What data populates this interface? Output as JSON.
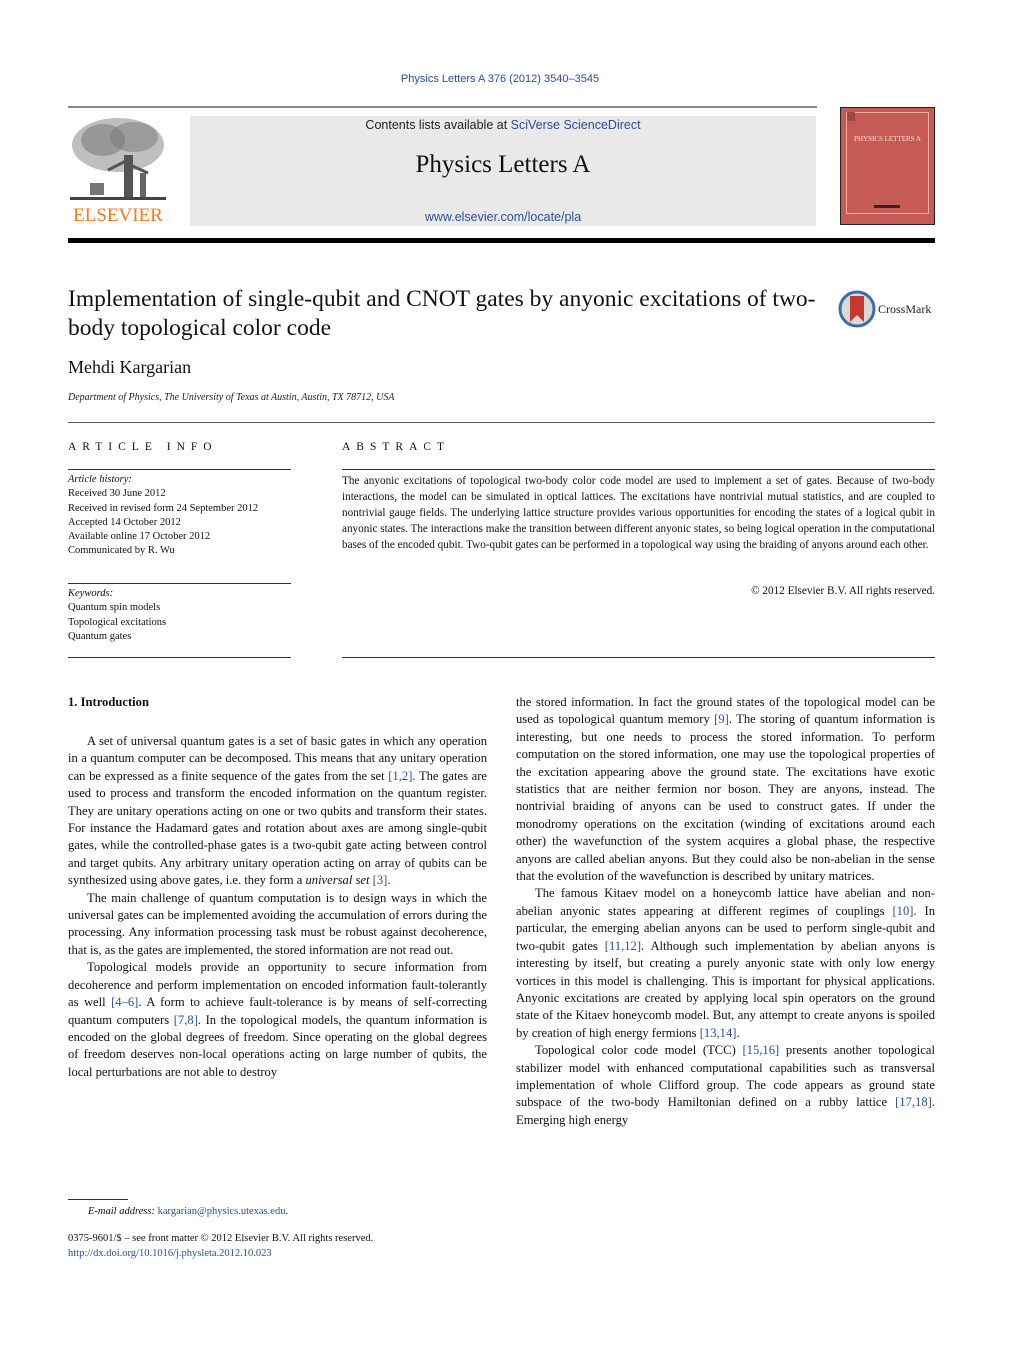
{
  "header": {
    "journal_ref": "Physics Letters A 376 (2012) 3540–3545",
    "contents_prefix": "Contents lists available at ",
    "contents_link": "SciVerse ScienceDirect",
    "journal_title": "Physics Letters A",
    "journal_url": "www.elsevier.com/locate/pla",
    "publisher_logo_text": "ELSEVIER",
    "cover_title": "PHYSICS LETTERS A",
    "colors": {
      "elsevier_orange": "#f07a20",
      "cover_red": "#c65a54",
      "link_blue": "#2a4f9a"
    }
  },
  "article": {
    "title": "Implementation of single-qubit and CNOT gates by anyonic excitations of two-body topological color code",
    "crossmark_label": "CrossMark",
    "author": "Mehdi Kargarian",
    "affiliation": "Department of Physics, The University of Texas at Austin, Austin, TX 78712, USA"
  },
  "article_info": {
    "heading": "ARTICLE INFO",
    "history_label": "Article history:",
    "history": [
      "Received 30 June 2012",
      "Received in revised form 24 September 2012",
      "Accepted 14 October 2012",
      "Available online 17 October 2012",
      "Communicated by R. Wu"
    ],
    "keywords_label": "Keywords:",
    "keywords": [
      "Quantum spin models",
      "Topological excitations",
      "Quantum gates"
    ]
  },
  "abstract": {
    "heading": "ABSTRACT",
    "text": "The anyonic excitations of topological two-body color code model are used to implement a set of gates. Because of two-body interactions, the model can be simulated in optical lattices. The excitations have nontrivial mutual statistics, and are coupled to nontrivial gauge fields. The underlying lattice structure provides various opportunities for encoding the states of a logical qubit in anyonic states. The interactions make the transition between different anyonic states, so being logical operation in the computational bases of the encoded qubit. Two-qubit gates can be performed in a topological way using the braiding of anyons around each other.",
    "copyright": "© 2012 Elsevier B.V. All rights reserved."
  },
  "body": {
    "section_title": "1.  Introduction",
    "p1": [
      "A set of universal quantum gates is a set of basic gates in which any operation in a quantum computer can be decomposed. This means that any unitary operation can be expressed as a finite sequence of the gates from the set ",
      "[1,2]",
      ". The gates are used to process and transform the encoded information on the quantum register. They are unitary operations acting on one or two qubits and transform their states. For instance the Hadamard gates and rotation about axes are among single-qubit gates, while the controlled-phase gates is a two-qubit gate acting between control and target qubits. Any arbitrary unitary operation acting on array of qubits can be synthesized using above gates, i.e. they form a ",
      "universal set",
      " ",
      "[3]",
      "."
    ],
    "p2": "The main challenge of quantum computation is to design ways in which the universal gates can be implemented avoiding the accumulation of errors during the processing. Any information processing task must be robust against decoherence, that is, as the gates are implemented, the stored information are not read out.",
    "p3": [
      "Topological models provide an opportunity to secure information from decoherence and perform implementation on encoded information fault-tolerantly as well ",
      "[4–6]",
      ". A form to achieve fault-tolerance is by means of self-correcting quantum computers ",
      "[7,8]",
      ". In the topological models, the quantum information is encoded on the global degrees of freedom. Since operating on the global degrees of freedom deserves non-local operations acting on large number of qubits, the local perturbations are not able to destroy"
    ],
    "p3_cont": [
      "the stored information. In fact the ground states of the topological model can be used as topological quantum memory ",
      "[9]",
      ". The storing of quantum information is interesting, but one needs to process the stored information. To perform computation on the stored information, one may use the topological properties of the excitation appearing above the ground state. The excitations have exotic statistics that are neither fermion nor boson. They are anyons, instead. The nontrivial braiding of anyons can be used to construct gates. If under the monodromy operations on the excitation (winding of excitations around each other) the wavefunction of the system acquires a global phase, the respective anyons are called abelian anyons. But they could also be non-abelian in the sense that the evolution of the wavefunction is described by unitary matrices."
    ],
    "p4": [
      "The famous Kitaev model on a honeycomb lattice have abelian and non-abelian anyonic states appearing at different regimes of couplings ",
      "[10]",
      ". In particular, the emerging abelian anyons can be used to perform single-qubit and two-qubit gates ",
      "[11,12]",
      ". Although such implementation by abelian anyons is interesting by itself, but creating a purely anyonic state with only low energy vortices in this model is challenging. This is important for physical applications. Anyonic excitations are created by applying local spin operators on the ground state of the Kitaev honeycomb model. But, any attempt to create anyons is spoiled by creation of high energy fermions ",
      "[13,14]",
      "."
    ],
    "p5": [
      "Topological color code model (TCC) ",
      "[15,16]",
      " presents another topological stabilizer model with enhanced computational capabilities such as transversal implementation of whole Clifford group. The code appears as ground state subspace of the two-body Hamiltonian defined on a rubby lattice ",
      "[17,18]",
      ". Emerging high energy"
    ]
  },
  "footer": {
    "email_label": "E-mail address:",
    "email": "kargarian@physics.utexas.edu",
    "email_suffix": ".",
    "front_matter": "0375-9601/$ – see front matter  © 2012 Elsevier B.V. All rights reserved.",
    "doi": "http://dx.doi.org/10.1016/j.physleta.2012.10.023"
  }
}
